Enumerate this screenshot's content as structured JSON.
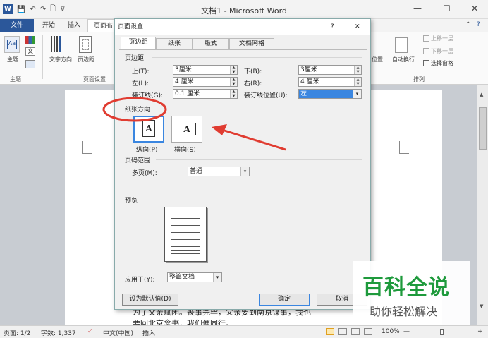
{
  "window": {
    "title": "文档1 - Microsoft Word",
    "min": "—",
    "max": "☐",
    "close": "✕"
  },
  "quickaccess": {
    "logo": "W",
    "icons": [
      "save-icon",
      "undo-icon",
      "redo-icon",
      "new-icon",
      "customize-icon"
    ],
    "glyphs": [
      "💾",
      "↶",
      "↷",
      "🗋",
      "⊽"
    ]
  },
  "tabs": [
    "文件",
    "开始",
    "插入",
    "页面布"
  ],
  "ribbon": {
    "theme_label": "主题",
    "theme_group": "主题",
    "text_dir": "文字方向",
    "margins": "页边距",
    "page_setup_group": "页面设置",
    "pos": "位置",
    "wrap": "自动换行",
    "bring_forward": "上移一层",
    "send_back": "下移一层",
    "selection_pane": "选择窗格",
    "arrange_group": "排列",
    "help": "?",
    "collapse": "⌃"
  },
  "dialog": {
    "title": "页面设置",
    "help": "?",
    "close": "✕",
    "tabs": [
      "页边距",
      "纸张",
      "版式",
      "文档网格"
    ],
    "margins_section": "页边距",
    "fields": {
      "top_label": "上(T):",
      "top_value": "3厘米",
      "bottom_label": "下(B):",
      "bottom_value": "3厘米",
      "left_label": "左(L):",
      "left_value": "4 厘米",
      "right_label": "右(R):",
      "right_value": "4 厘米",
      "gutter_label": "装订线(G):",
      "gutter_value": "0.1 厘米",
      "gutter_pos_label": "装订线位置(U):",
      "gutter_pos_value": "左"
    },
    "orientation_section": "纸张方向",
    "portrait": "纵向(P)",
    "landscape": "横向(S)",
    "orient_glyph": "A",
    "pages_section": "页码范围",
    "multiple_label": "多页(M):",
    "multiple_value": "普通",
    "preview_section": "预览",
    "apply_label": "应用于(Y):",
    "apply_value": "整篇文档",
    "default_btn": "设为默认值(D)",
    "ok_btn": "确定",
    "cancel_btn": "取消"
  },
  "document": {
    "line1": "为了父亲赋闲。丧事完毕，父亲要到南京谋事，我也",
    "line2": "要回北京念书，我们便同行。"
  },
  "status": {
    "page": "页面: 1/2",
    "words": "字数: 1,337",
    "lang": "中文(中国)",
    "mode": "插入",
    "zoom": "100%",
    "minus": "—",
    "plus": "+"
  },
  "watermark": {
    "title": "百科全说",
    "subtitle": "助你轻松解决"
  },
  "colors": {
    "accent": "#2b579a",
    "annotation": "#e03c31",
    "watermark_green": "#1e9a3c"
  }
}
